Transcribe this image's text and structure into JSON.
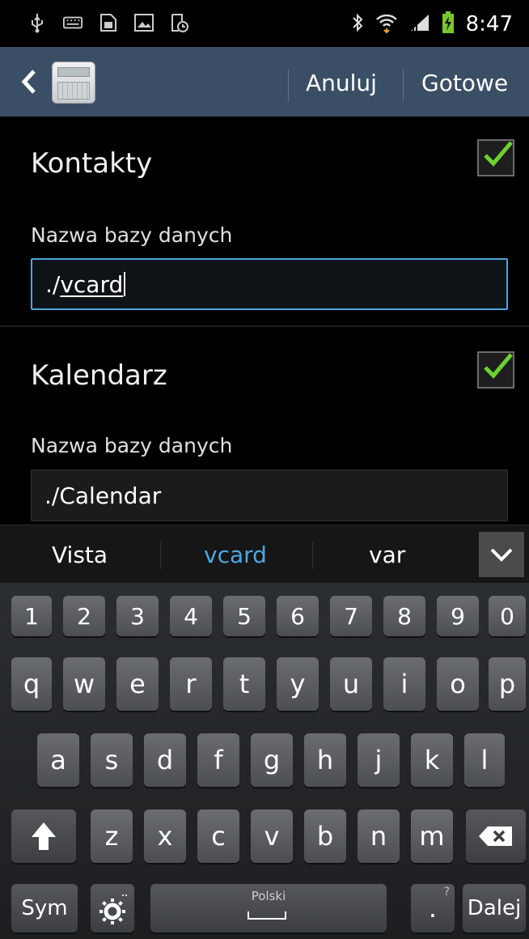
{
  "status_bar": {
    "time": "8:47",
    "left_icons": [
      "usb-icon",
      "keyboard-icon",
      "sim-card-icon",
      "image-icon",
      "sync-icon"
    ],
    "right_icons": [
      "bluetooth-icon",
      "wifi-icon",
      "signal-icon",
      "battery-charging-icon"
    ]
  },
  "action_bar": {
    "cancel_label": "Anuluj",
    "done_label": "Gotowe",
    "background": "#3a4f66"
  },
  "sections": [
    {
      "title": "Kontakty",
      "checked": true,
      "field_label": "Nazwa bazy danych",
      "field_prefix": "./",
      "field_typed": "vcard",
      "focused": true
    },
    {
      "title": "Kalendarz",
      "checked": true,
      "field_label": "Nazwa bazy danych",
      "field_value": "./Calendar",
      "focused": false
    }
  ],
  "suggestions": {
    "left": "Vista",
    "middle": "vcard",
    "right": "var"
  },
  "keyboard": {
    "numbers": [
      "1",
      "2",
      "3",
      "4",
      "5",
      "6",
      "7",
      "8",
      "9",
      "0"
    ],
    "row1": [
      "q",
      "w",
      "e",
      "r",
      "t",
      "y",
      "u",
      "i",
      "o",
      "p"
    ],
    "row2": [
      "a",
      "s",
      "d",
      "f",
      "g",
      "h",
      "j",
      "k",
      "l"
    ],
    "row3": [
      "z",
      "x",
      "c",
      "v",
      "b",
      "n",
      "m"
    ],
    "sym_label": "Sym",
    "space_label": "Polski",
    "period_label": ".",
    "period_hint": "?",
    "next_label": "Dalej"
  },
  "colors": {
    "accent": "#4ea5d9",
    "check": "#6cd12e"
  }
}
